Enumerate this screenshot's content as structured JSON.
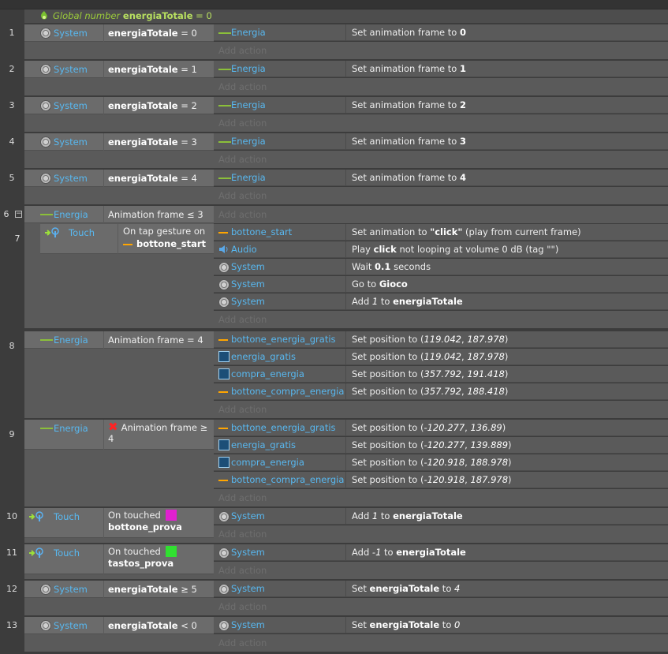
{
  "global_var": {
    "prefix": "Global number",
    "name": "energiaTotale",
    "value": "= 0"
  },
  "colors": {
    "pink": "#e020d0",
    "green": "#30e030",
    "object_blue": "#58b8f0",
    "global_green": "#9ccc3a"
  },
  "add_action_label": "Add action",
  "events": [
    {
      "num": "1",
      "obj": "System",
      "cond_pre": "",
      "cond_bold": "energiaTotale",
      "cond_post": " = 0",
      "actions": [
        {
          "obj": "Energia",
          "icon": "line",
          "pre": "Set animation frame to ",
          "b1": "0"
        }
      ]
    },
    {
      "num": "2",
      "obj": "System",
      "cond_bold": "energiaTotale",
      "cond_post": " = 1",
      "actions": [
        {
          "obj": "Energia",
          "icon": "line",
          "pre": "Set animation frame to ",
          "b1": "1"
        }
      ]
    },
    {
      "num": "3",
      "obj": "System",
      "cond_bold": "energiaTotale",
      "cond_post": " = 2",
      "actions": [
        {
          "obj": "Energia",
          "icon": "line",
          "pre": "Set animation frame to ",
          "b1": "2"
        }
      ]
    },
    {
      "num": "4",
      "obj": "System",
      "cond_bold": "energiaTotale",
      "cond_post": " = 3",
      "actions": [
        {
          "obj": "Energia",
          "icon": "line",
          "pre": "Set animation frame to ",
          "b1": "3"
        }
      ]
    },
    {
      "num": "5",
      "obj": "System",
      "cond_bold": "energiaTotale",
      "cond_post": " = 4",
      "actions": [
        {
          "obj": "Energia",
          "icon": "line",
          "pre": "Set animation frame to ",
          "b1": "4"
        }
      ]
    },
    {
      "num": "6",
      "obj": "Energia",
      "cond_text": "Animation frame ≤ 3",
      "sub": {
        "num": "7",
        "obj": "Touch",
        "cond_line1": "On tap gesture on",
        "cond_line2": "bottone_start",
        "actions": [
          {
            "obj": "bottone_start",
            "icon": "orange",
            "pre": "Set animation to ",
            "b1": "\"click\"",
            "post": " (play from current frame)"
          },
          {
            "obj": "Audio",
            "icon": "audio",
            "pre": "Play ",
            "b1": "click",
            "post": " not looping at volume 0 dB (tag \"\")"
          },
          {
            "obj": "System",
            "icon": "gear",
            "pre": "Wait ",
            "b1": "0.1",
            "post": " seconds"
          },
          {
            "obj": "System",
            "icon": "gear",
            "pre": "Go to ",
            "b1": "Gioco"
          },
          {
            "obj": "System",
            "icon": "gear",
            "pre": "Add ",
            "i1": "1",
            "mid": " to ",
            "b1": "energiaTotale"
          }
        ]
      }
    },
    {
      "num": "8",
      "obj": "Energia",
      "cond_text": "Animation frame = 4",
      "actions": [
        {
          "obj": "bottone_energia_gratis",
          "icon": "orange",
          "pre": "Set position to (",
          "i1": "119.042",
          "mid": ", ",
          "i2": "187.978",
          "post": ")"
        },
        {
          "obj": "energia_gratis",
          "icon": "sprite",
          "pre": "Set position to (",
          "i1": "119.042",
          "mid": ", ",
          "i2": "187.978",
          "post": ")"
        },
        {
          "obj": "compra_energia",
          "icon": "sprite",
          "pre": "Set position to (",
          "i1": "357.792",
          "mid": ", ",
          "i2": "191.418",
          "post": ")"
        },
        {
          "obj": "bottone_compra_energia",
          "icon": "orange",
          "pre": "Set position to (",
          "i1": "357.792",
          "mid": ", ",
          "i2": "188.418",
          "post": ")"
        }
      ]
    },
    {
      "num": "9",
      "obj": "Energia",
      "cond_line1": "Animation frame ≥",
      "cond_line2": "4",
      "actions": [
        {
          "obj": "bottone_energia_gratis",
          "icon": "orange",
          "pre": "Set position to (",
          "i1": "-120.277",
          "mid": ", ",
          "i2": "136.89",
          "post": ")"
        },
        {
          "obj": "energia_gratis",
          "icon": "sprite",
          "pre": "Set position to (",
          "i1": "-120.277",
          "mid": ", ",
          "i2": "139.889",
          "post": ")"
        },
        {
          "obj": "compra_energia",
          "icon": "sprite",
          "pre": "Set position to (",
          "i1": "-120.918",
          "mid": ", ",
          "i2": "188.978",
          "post": ")"
        },
        {
          "obj": "bottone_compra_energia",
          "icon": "orange",
          "pre": "Set position to (",
          "i1": "-120.918",
          "mid": ", ",
          "i2": "187.978",
          "post": ")"
        }
      ]
    },
    {
      "num": "10",
      "obj": "Touch",
      "cond_line1": "On touched",
      "cond_line2": "bottone_prova",
      "actions": [
        {
          "obj": "System",
          "icon": "gear",
          "pre": "Add ",
          "i1": "1",
          "mid": " to ",
          "b1": "energiaTotale"
        }
      ]
    },
    {
      "num": "11",
      "obj": "Touch",
      "cond_line1": "On touched",
      "cond_line2": "tastos_prova",
      "actions": [
        {
          "obj": "System",
          "icon": "gear",
          "pre": "Add ",
          "i1": "-1",
          "mid": " to ",
          "b1": "energiaTotale"
        }
      ]
    },
    {
      "num": "12",
      "obj": "System",
      "cond_bold": "energiaTotale",
      "cond_post": " ≥ 5",
      "actions": [
        {
          "obj": "System",
          "icon": "gear",
          "pre": "Set ",
          "b1": "energiaTotale",
          "mid": " to ",
          "i1": "4"
        }
      ]
    },
    {
      "num": "13",
      "obj": "System",
      "cond_bold": "energiaTotale",
      "cond_post": " < 0",
      "actions": [
        {
          "obj": "System",
          "icon": "gear",
          "pre": "Set ",
          "b1": "energiaTotale",
          "mid": " to ",
          "i1": "0"
        }
      ]
    }
  ]
}
